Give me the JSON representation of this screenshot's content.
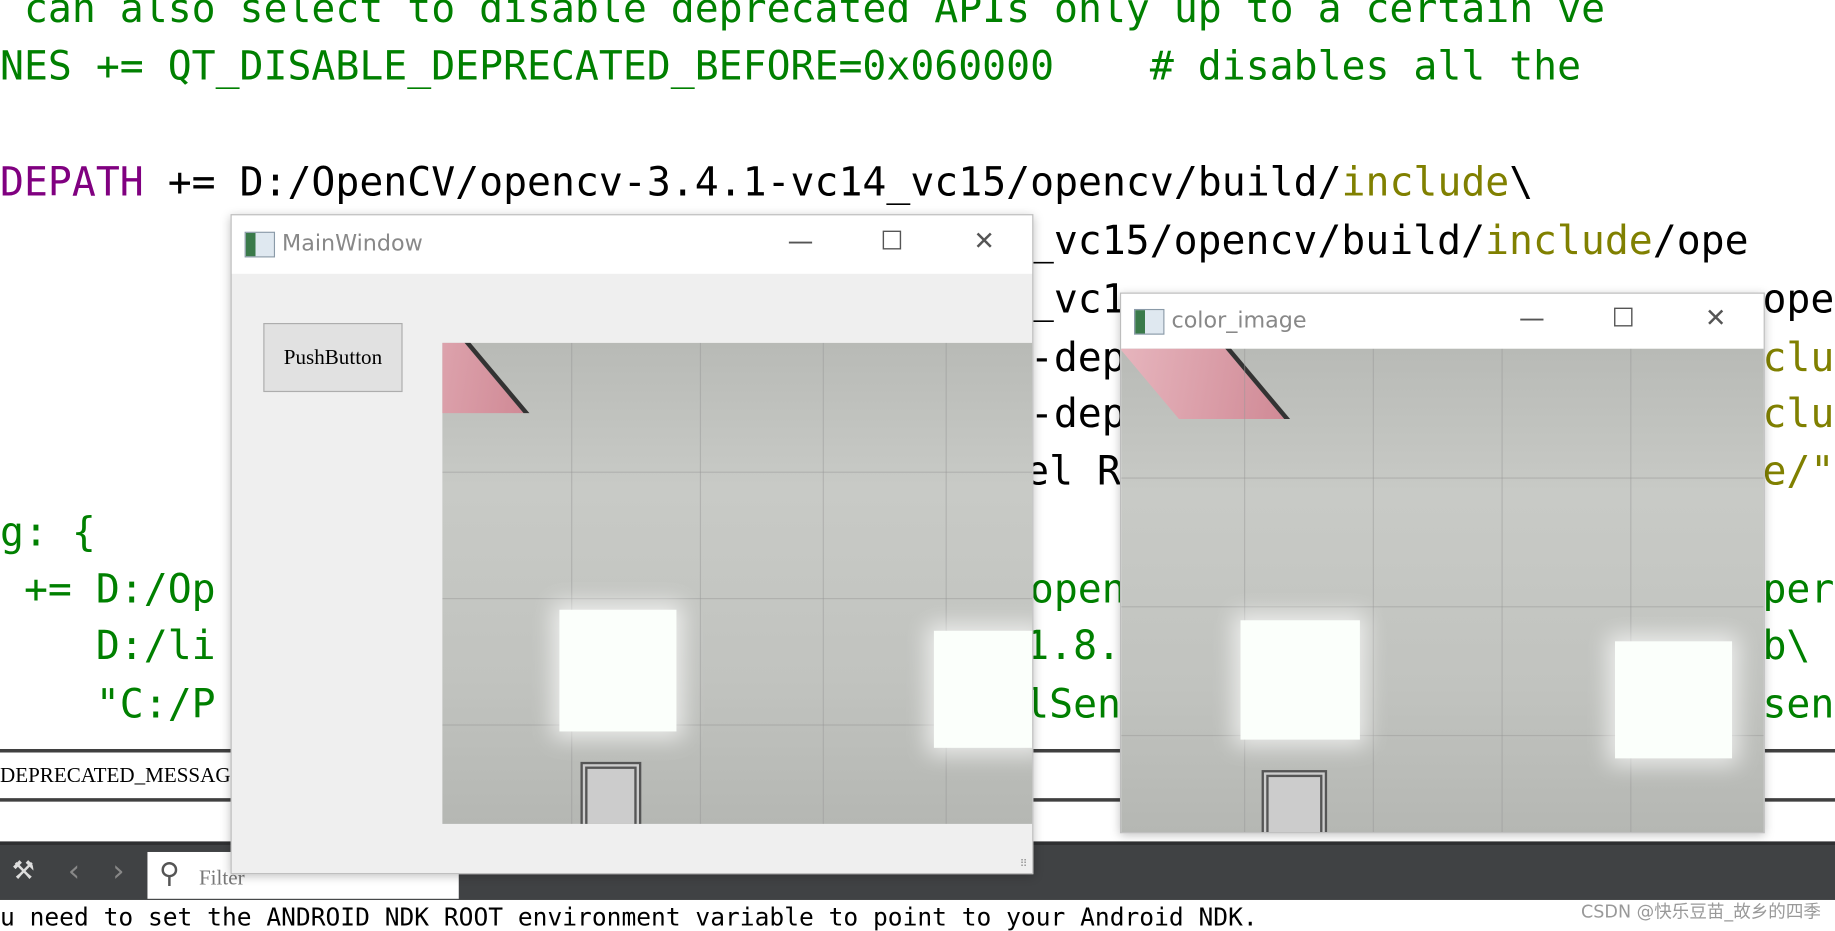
{
  "editor": {
    "lines": [
      {
        "text": " can also select to disable deprecated APIs only up to a certain ve"
      },
      {
        "text": "NES += QT_DISABLE_DEPRECATED_BEFORE=0x060000    # disables all the"
      },
      {
        "a": "DEPATH",
        "b": " += D:/OpenCV/opencv-3.4.1-vc14_vc15/opencv/build/",
        "c": "include",
        "d": "\\"
      },
      {
        "a": "_vc15/opencv/build/",
        "b": "include",
        "c": "/ope"
      },
      {
        "a": "_vc1",
        "b": "ope"
      },
      {
        "a": "-dep",
        "b": "clu"
      },
      {
        "a": "-dep",
        "b": "clu"
      },
      {
        "a": "el R",
        "b": "e/\""
      },
      {
        "text": "g: {"
      },
      {
        "a": " += D:/Op",
        "b": "open",
        "c": "per"
      },
      {
        "a": "    D:/li",
        "b": "1.8.",
        "c": "b\\"
      },
      {
        "a": "    \"C:/P",
        "b": "lSen",
        "c": "sen"
      }
    ],
    "message": "DEPRECATED_MESSAGE",
    "filter_placeholder": "Filter",
    "bottom_text": "u need to set the ANDROID_NDK_ROOT environment variable to point to your Android NDK.",
    "watermark": "CSDN @快乐豆苗_故乡的四季"
  },
  "main_window": {
    "title": "MainWindow",
    "minimize": "—",
    "maximize": "☐",
    "close": "✕",
    "push_button": "PushButton"
  },
  "color_window": {
    "title": "color_image",
    "minimize": "—",
    "maximize": "☐",
    "close": "✕"
  },
  "colors": {
    "comment": "#008000",
    "keyword": "#800080",
    "include": "#808000",
    "toolbar": "#404244"
  }
}
